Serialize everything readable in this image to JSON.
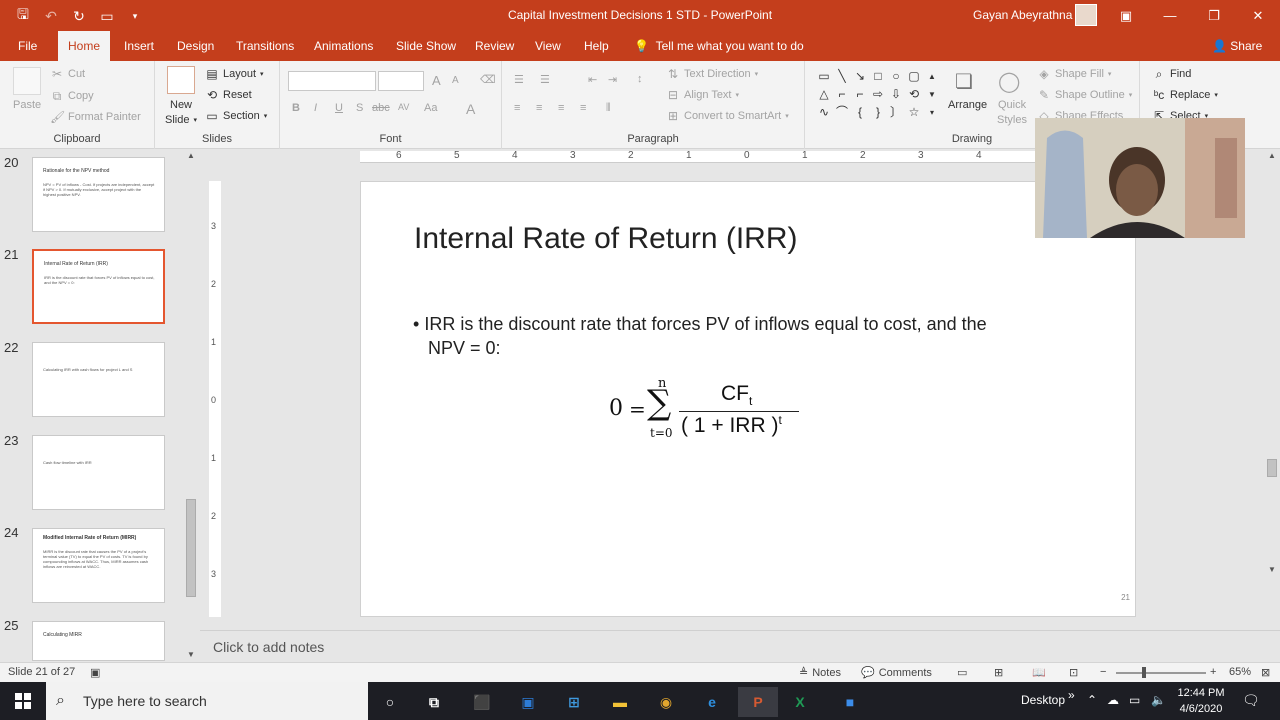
{
  "app": {
    "doc_title": "Capital Investment Decisions 1 STD  -  PowerPoint",
    "user_name": "Gayan Abeyrathna"
  },
  "tabs": [
    "File",
    "Home",
    "Insert",
    "Design",
    "Transitions",
    "Animations",
    "Slide Show",
    "Review",
    "View",
    "Help"
  ],
  "tell_me": "Tell me what you want to do",
  "share": "Share",
  "ribbon": {
    "clipboard": {
      "label": "Clipboard",
      "paste": "Paste",
      "cut": "Cut",
      "copy": "Copy",
      "format_painter": "Format Painter"
    },
    "slides": {
      "label": "Slides",
      "new_slide": "New",
      "new_slide2": "Slide",
      "layout": "Layout",
      "reset": "Reset",
      "section": "Section"
    },
    "font": {
      "label": "Font",
      "bold": "B",
      "italic": "I",
      "underline": "U",
      "strike": "S",
      "shadow": "abc",
      "spacing": "AV",
      "case": "Aa",
      "grow": "A",
      "shrink": "A"
    },
    "paragraph": {
      "label": "Paragraph",
      "text_direction": "Text Direction",
      "align_text": "Align Text",
      "smartart": "Convert to SmartArt"
    },
    "drawing": {
      "label": "Drawing",
      "arrange": "Arrange",
      "quick_styles": "Quick",
      "quick_styles2": "Styles",
      "shape_fill": "Shape Fill",
      "shape_outline": "Shape Outline",
      "shape_effects": "Shape Effects"
    },
    "editing": {
      "find": "Find",
      "replace": "Replace",
      "select": "Select"
    }
  },
  "slides": [
    {
      "num": "20",
      "title": "Rationale for the NPV method",
      "body": "NPV = PV of inflows - Cost. If projects are independent, accept if NPV > 0. If mutually exclusive, accept project with the highest positive NPV."
    },
    {
      "num": "21",
      "title": "Internal Rate of Return (IRR)",
      "body": "IRR is the discount rate that forces PV of inflows equal to cost, and the NPV = 0:"
    },
    {
      "num": "22",
      "title": "",
      "body": "Calculating IRR with cash flows for project L and S"
    },
    {
      "num": "23",
      "title": "",
      "body": "Cash flow timeline with IRR"
    },
    {
      "num": "24",
      "title": "Modified Internal Rate of Return (MIRR)",
      "body": "MIRR is the discount rate that causes the PV of a project's terminal value (TV) to equal the PV of costs. TV is found by compounding inflows at WACC. Thus, MIRR assumes cash inflows are reinvested at WACC."
    },
    {
      "num": "25",
      "title": "Calculating MIRR",
      "body": ""
    }
  ],
  "current_slide": {
    "title": "Internal Rate of Return (IRR)",
    "bullet_marker": "•",
    "bullet": "IRR is the discount rate that forces PV of inflows equal to cost, and the NPV = 0:",
    "formula": {
      "lhs": "0",
      "eq": "=",
      "sigma": "∑",
      "upper": "n",
      "lower": "t=0",
      "numerator": "CF",
      "num_sub": "t",
      "denominator": "( 1 + IRR )",
      "den_sup": "t"
    },
    "page_number": "21"
  },
  "ruler": {
    "h": [
      "6",
      "5",
      "4",
      "3",
      "2",
      "1",
      "0",
      "1",
      "2",
      "3",
      "4"
    ],
    "v": [
      "3",
      "2",
      "1",
      "0",
      "1",
      "2",
      "3"
    ]
  },
  "notes_placeholder": "Click to add notes",
  "statusbar": {
    "slide_info": "Slide 21 of 27",
    "notes": "Notes",
    "comments": "Comments",
    "zoom": "65%",
    "zoom_level_percent": 65
  },
  "taskbar": {
    "search_placeholder": "Type here to search",
    "desktop": "Desktop",
    "time": "12:44 PM",
    "date": "4/6/2020"
  },
  "colors": {
    "accent": "#c43e1c",
    "selected_border": "#e4562f"
  }
}
